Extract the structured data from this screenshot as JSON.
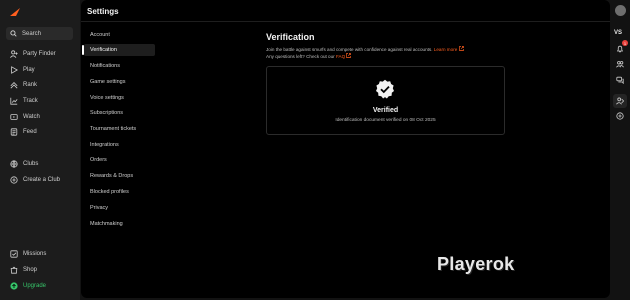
{
  "nav": {
    "search_label": "Search",
    "items": [
      {
        "label": "Party Finder",
        "icon": "user-plus-icon"
      },
      {
        "label": "Play",
        "icon": "play-icon"
      },
      {
        "label": "Rank",
        "icon": "rank-icon"
      },
      {
        "label": "Track",
        "icon": "chart-icon"
      },
      {
        "label": "Watch",
        "icon": "watch-icon"
      },
      {
        "label": "Feed",
        "icon": "feed-icon"
      },
      {
        "label": "Clubs",
        "icon": "clubs-icon"
      },
      {
        "label": "Create a Club",
        "icon": "plus-circle-icon"
      },
      {
        "label": "Missions",
        "icon": "missions-icon"
      },
      {
        "label": "Shop",
        "icon": "shop-icon"
      },
      {
        "label": "Upgrade",
        "icon": "upgrade-icon"
      }
    ]
  },
  "settings": {
    "title": "Settings",
    "menu": [
      "Account",
      "Verification",
      "Notifications",
      "Game settings",
      "Voice settings",
      "Subscriptions",
      "Tournament tickets",
      "Integrations",
      "Orders",
      "Rewards & Drops",
      "Blocked profiles",
      "Privacy",
      "Matchmaking"
    ],
    "active": "Verification"
  },
  "verification": {
    "title": "Verification",
    "line1": "Join the battle against smurfs and compete with confidence against real accounts.",
    "learn_more": "Learn more",
    "line2": "Any questions left? Check out our",
    "faq": "FAQ",
    "status": "Verified",
    "status_detail": "Identification document verified on 08 Oct 2025"
  },
  "rail": {
    "vs_label": "VS",
    "notification_count": "1"
  },
  "watermark": "Playerok",
  "colors": {
    "accent": "#ff5f1f",
    "upgrade": "#37c56a",
    "badge": "#e8413c"
  }
}
